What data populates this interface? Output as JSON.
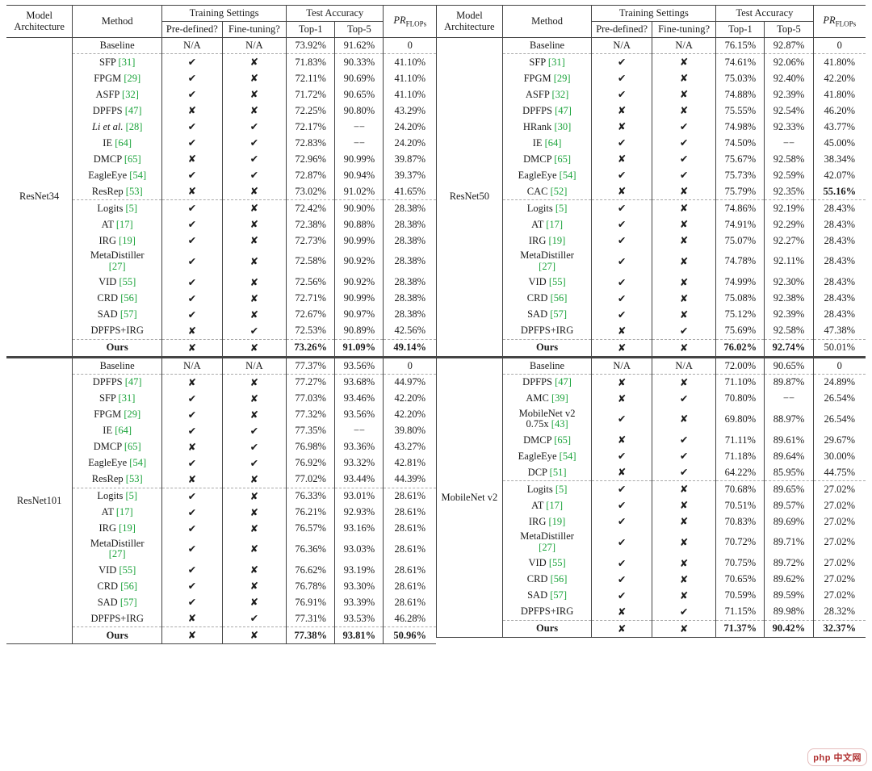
{
  "glyphs": {
    "tick": "✔",
    "cross": "✘",
    "dashes": "−−"
  },
  "headers": {
    "arch_l1": "Model",
    "arch_l2": "Architecture",
    "method": "Method",
    "ts": "Training Settings",
    "pd": "Pre-defined?",
    "ft": "Fine-tuning?",
    "ta": "Test Accuracy",
    "top1": "Top-1",
    "top5": "Top-5",
    "pr_prefix": "PR",
    "pr_sub": "FLOPs"
  },
  "blocks": [
    {
      "left": {
        "arch": "ResNet34",
        "groups": [
          {
            "rows": [
              {
                "method": "Baseline",
                "pd": "N/A",
                "ft": "N/A",
                "top1": "73.92%",
                "top5": "91.62%",
                "pr": "0"
              }
            ]
          },
          {
            "rows": [
              {
                "method": "SFP",
                "cite": "[31]",
                "pd": "T",
                "ft": "X",
                "top1": "71.83%",
                "top5": "90.33%",
                "pr": "41.10%"
              },
              {
                "method": "FPGM",
                "cite": "[29]",
                "pd": "T",
                "ft": "X",
                "top1": "72.11%",
                "top5": "90.69%",
                "pr": "41.10%"
              },
              {
                "method": "ASFP",
                "cite": "[32]",
                "pd": "T",
                "ft": "X",
                "top1": "71.72%",
                "top5": "90.65%",
                "pr": "41.10%"
              },
              {
                "method": "DPFPS",
                "cite": "[47]",
                "pd": "X",
                "ft": "X",
                "top1": "72.25%",
                "top5": "90.80%",
                "pr": "43.29%"
              },
              {
                "method": "Li et al.",
                "cite": "[28]",
                "itm": true,
                "pd": "T",
                "ft": "T",
                "top1": "72.17%",
                "top5": "DASH",
                "pr": "24.20%"
              },
              {
                "method": "IE",
                "cite": "[64]",
                "pd": "T",
                "ft": "T",
                "top1": "72.83%",
                "top5": "DASH",
                "pr": "24.20%"
              },
              {
                "method": "DMCP",
                "cite": "[65]",
                "pd": "X",
                "ft": "T",
                "top1": "72.96%",
                "top5": "90.99%",
                "pr": "39.87%"
              },
              {
                "method": "EagleEye",
                "cite": "[54]",
                "pd": "T",
                "ft": "T",
                "top1": "72.87%",
                "top5": "90.94%",
                "pr": "39.37%"
              },
              {
                "method": "ResRep",
                "cite": "[53]",
                "pd": "X",
                "ft": "X",
                "top1": "73.02%",
                "top5": "91.02%",
                "pr": "41.65%"
              }
            ]
          },
          {
            "rows": [
              {
                "method": "Logits",
                "cite": "[5]",
                "pd": "T",
                "ft": "X",
                "top1": "72.42%",
                "top5": "90.90%",
                "pr": "28.38%"
              },
              {
                "method": "AT",
                "cite": "[17]",
                "pd": "T",
                "ft": "X",
                "top1": "72.38%",
                "top5": "90.88%",
                "pr": "28.38%"
              },
              {
                "method": "IRG",
                "cite": "[19]",
                "pd": "T",
                "ft": "X",
                "top1": "72.73%",
                "top5": "90.99%",
                "pr": "28.38%"
              },
              {
                "method": "MetaDistiller",
                "cite": "[27]",
                "twoLine": true,
                "pd": "T",
                "ft": "X",
                "top1": "72.58%",
                "top5": "90.92%",
                "pr": "28.38%"
              },
              {
                "method": "VID",
                "cite": "[55]",
                "pd": "T",
                "ft": "X",
                "top1": "72.56%",
                "top5": "90.92%",
                "pr": "28.38%"
              },
              {
                "method": "CRD",
                "cite": "[56]",
                "pd": "T",
                "ft": "X",
                "top1": "72.71%",
                "top5": "90.99%",
                "pr": "28.38%"
              },
              {
                "method": "SAD",
                "cite": "[57]",
                "pd": "T",
                "ft": "X",
                "top1": "72.67%",
                "top5": "90.97%",
                "pr": "28.38%"
              },
              {
                "method": "DPFPS+IRG",
                "pd": "X",
                "ft": "T",
                "top1": "72.53%",
                "top5": "90.89%",
                "pr": "42.56%"
              }
            ]
          },
          {
            "rows": [
              {
                "method": "Ours",
                "bold": true,
                "pd": "X",
                "ft": "X",
                "top1": "73.26%",
                "top5": "91.09%",
                "pr": "49.14%",
                "boldRow": true
              }
            ]
          }
        ]
      },
      "right": {
        "arch": "ResNet50",
        "groups": [
          {
            "rows": [
              {
                "method": "Baseline",
                "pd": "N/A",
                "ft": "N/A",
                "top1": "76.15%",
                "top5": "92.87%",
                "pr": "0"
              }
            ]
          },
          {
            "rows": [
              {
                "method": "SFP",
                "cite": "[31]",
                "pd": "T",
                "ft": "X",
                "top1": "74.61%",
                "top5": "92.06%",
                "pr": "41.80%"
              },
              {
                "method": "FPGM",
                "cite": "[29]",
                "pd": "T",
                "ft": "X",
                "top1": "75.03%",
                "top5": "92.40%",
                "pr": "42.20%"
              },
              {
                "method": "ASFP",
                "cite": "[32]",
                "pd": "T",
                "ft": "X",
                "top1": "74.88%",
                "top5": "92.39%",
                "pr": "41.80%"
              },
              {
                "method": "DPFPS",
                "cite": "[47]",
                "pd": "X",
                "ft": "X",
                "top1": "75.55%",
                "top5": "92.54%",
                "pr": "46.20%"
              },
              {
                "method": "HRank",
                "cite": "[30]",
                "pd": "X",
                "ft": "T",
                "top1": "74.98%",
                "top5": "92.33%",
                "pr": "43.77%"
              },
              {
                "method": "IE",
                "cite": "[64]",
                "pd": "T",
                "ft": "T",
                "top1": "74.50%",
                "top5": "DASH",
                "pr": "45.00%"
              },
              {
                "method": "DMCP",
                "cite": "[65]",
                "pd": "X",
                "ft": "T",
                "top1": "75.67%",
                "top5": "92.58%",
                "pr": "38.34%"
              },
              {
                "method": "EagleEye",
                "cite": "[54]",
                "pd": "T",
                "ft": "T",
                "top1": "75.73%",
                "top5": "92.59%",
                "pr": "42.07%"
              },
              {
                "method": "CAC",
                "cite": "[52]",
                "pd": "X",
                "ft": "X",
                "top1": "75.79%",
                "top5": "92.35%",
                "pr": "55.16%",
                "boldPr": true
              }
            ]
          },
          {
            "rows": [
              {
                "method": "Logits",
                "cite": "[5]",
                "pd": "T",
                "ft": "X",
                "top1": "74.86%",
                "top5": "92.19%",
                "pr": "28.43%"
              },
              {
                "method": "AT",
                "cite": "[17]",
                "pd": "T",
                "ft": "X",
                "top1": "74.91%",
                "top5": "92.29%",
                "pr": "28.43%"
              },
              {
                "method": "IRG",
                "cite": "[19]",
                "pd": "T",
                "ft": "X",
                "top1": "75.07%",
                "top5": "92.27%",
                "pr": "28.43%"
              },
              {
                "method": "MetaDistiller",
                "cite": "[27]",
                "twoLine": true,
                "pd": "T",
                "ft": "X",
                "top1": "74.78%",
                "top5": "92.11%",
                "pr": "28.43%"
              },
              {
                "method": "VID",
                "cite": "[55]",
                "pd": "T",
                "ft": "X",
                "top1": "74.99%",
                "top5": "92.30%",
                "pr": "28.43%"
              },
              {
                "method": "CRD",
                "cite": "[56]",
                "pd": "T",
                "ft": "X",
                "top1": "75.08%",
                "top5": "92.38%",
                "pr": "28.43%"
              },
              {
                "method": "SAD",
                "cite": "[57]",
                "pd": "T",
                "ft": "X",
                "top1": "75.12%",
                "top5": "92.39%",
                "pr": "28.43%"
              },
              {
                "method": "DPFPS+IRG",
                "pd": "X",
                "ft": "T",
                "top1": "75.69%",
                "top5": "92.58%",
                "pr": "47.38%"
              }
            ]
          },
          {
            "rows": [
              {
                "method": "Ours",
                "bold": true,
                "pd": "X",
                "ft": "X",
                "top1": "76.02%",
                "top5": "92.74%",
                "pr": "50.01%",
                "boldRow": true,
                "prNormal": true
              }
            ]
          }
        ]
      }
    },
    {
      "left": {
        "arch": "ResNet101",
        "groups": [
          {
            "rows": [
              {
                "method": "Baseline",
                "pd": "N/A",
                "ft": "N/A",
                "top1": "77.37%",
                "top5": "93.56%",
                "pr": "0"
              }
            ]
          },
          {
            "rows": [
              {
                "method": "DPFPS",
                "cite": "[47]",
                "pd": "X",
                "ft": "X",
                "top1": "77.27%",
                "top5": "93.68%",
                "pr": "44.97%"
              },
              {
                "method": "SFP",
                "cite": "[31]",
                "pd": "T",
                "ft": "X",
                "top1": "77.03%",
                "top5": "93.46%",
                "pr": "42.20%"
              },
              {
                "method": "FPGM",
                "cite": "[29]",
                "pd": "T",
                "ft": "X",
                "top1": "77.32%",
                "top5": "93.56%",
                "pr": "42.20%"
              },
              {
                "method": "IE",
                "cite": "[64]",
                "pd": "T",
                "ft": "T",
                "top1": "77.35%",
                "top5": "DASH",
                "pr": "39.80%"
              },
              {
                "method": "DMCP",
                "cite": "[65]",
                "pd": "X",
                "ft": "T",
                "top1": "76.98%",
                "top5": "93.36%",
                "pr": "43.27%"
              },
              {
                "method": "EagleEye",
                "cite": "[54]",
                "pd": "T",
                "ft": "T",
                "top1": "76.92%",
                "top5": "93.32%",
                "pr": "42.81%"
              },
              {
                "method": "ResRep",
                "cite": "[53]",
                "pd": "X",
                "ft": "X",
                "top1": "77.02%",
                "top5": "93.44%",
                "pr": "44.39%"
              }
            ]
          },
          {
            "rows": [
              {
                "method": "Logits",
                "cite": "[5]",
                "pd": "T",
                "ft": "X",
                "top1": "76.33%",
                "top5": "93.01%",
                "pr": "28.61%"
              },
              {
                "method": "AT",
                "cite": "[17]",
                "pd": "T",
                "ft": "X",
                "top1": "76.21%",
                "top5": "92.93%",
                "pr": "28.61%"
              },
              {
                "method": "IRG",
                "cite": "[19]",
                "pd": "T",
                "ft": "X",
                "top1": "76.57%",
                "top5": "93.16%",
                "pr": "28.61%"
              },
              {
                "method": "MetaDistiller",
                "cite": "[27]",
                "twoLine": true,
                "pd": "T",
                "ft": "X",
                "top1": "76.36%",
                "top5": "93.03%",
                "pr": "28.61%"
              },
              {
                "method": "VID",
                "cite": "[55]",
                "pd": "T",
                "ft": "X",
                "top1": "76.62%",
                "top5": "93.19%",
                "pr": "28.61%"
              },
              {
                "method": "CRD",
                "cite": "[56]",
                "pd": "T",
                "ft": "X",
                "top1": "76.78%",
                "top5": "93.30%",
                "pr": "28.61%"
              },
              {
                "method": "SAD",
                "cite": "[57]",
                "pd": "T",
                "ft": "X",
                "top1": "76.91%",
                "top5": "93.39%",
                "pr": "28.61%"
              },
              {
                "method": "DPFPS+IRG",
                "pd": "X",
                "ft": "T",
                "top1": "77.31%",
                "top5": "93.53%",
                "pr": "46.28%"
              }
            ]
          },
          {
            "rows": [
              {
                "method": "Ours",
                "bold": true,
                "pd": "X",
                "ft": "X",
                "top1": "77.38%",
                "top5": "93.81%",
                "pr": "50.96%",
                "boldRow": true
              }
            ]
          }
        ]
      },
      "right": {
        "arch": "MobileNet v2",
        "groups": [
          {
            "rows": [
              {
                "method": "Baseline",
                "pd": "N/A",
                "ft": "N/A",
                "top1": "72.00%",
                "top5": "90.65%",
                "pr": "0"
              }
            ]
          },
          {
            "rows": [
              {
                "method": "DPFPS",
                "cite": "[47]",
                "pd": "X",
                "ft": "X",
                "top1": "71.10%",
                "top5": "89.87%",
                "pr": "24.89%"
              },
              {
                "method": "AMC",
                "cite": "[39]",
                "pd": "X",
                "ft": "T",
                "top1": "70.80%",
                "top5": "DASH",
                "pr": "26.54%"
              },
              {
                "method": "MobileNet v2 0.75x",
                "cite": "[43]",
                "twoLine": true,
                "methodLines": [
                  "MobileNet v2",
                  "0.75x"
                ],
                "pd": "T",
                "ft": "X",
                "top1": "69.80%",
                "top5": "88.97%",
                "pr": "26.54%"
              },
              {
                "method": "DMCP",
                "cite": "[65]",
                "pd": "X",
                "ft": "T",
                "top1": "71.11%",
                "top5": "89.61%",
                "pr": "29.67%"
              },
              {
                "method": "EagleEye",
                "cite": "[54]",
                "pd": "T",
                "ft": "T",
                "top1": "71.18%",
                "top5": "89.64%",
                "pr": "30.00%"
              },
              {
                "method": "DCP",
                "cite": "[51]",
                "pd": "X",
                "ft": "T",
                "top1": "64.22%",
                "top5": "85.95%",
                "pr": "44.75%"
              }
            ]
          },
          {
            "rows": [
              {
                "method": "Logits",
                "cite": "[5]",
                "pd": "T",
                "ft": "X",
                "top1": "70.68%",
                "top5": "89.65%",
                "pr": "27.02%"
              },
              {
                "method": "AT",
                "cite": "[17]",
                "pd": "T",
                "ft": "X",
                "top1": "70.51%",
                "top5": "89.57%",
                "pr": "27.02%"
              },
              {
                "method": "IRG",
                "cite": "[19]",
                "pd": "T",
                "ft": "X",
                "top1": "70.83%",
                "top5": "89.69%",
                "pr": "27.02%"
              },
              {
                "method": "MetaDistiller",
                "cite": "[27]",
                "twoLine": true,
                "pd": "T",
                "ft": "X",
                "top1": "70.72%",
                "top5": "89.71%",
                "pr": "27.02%"
              },
              {
                "method": "VID",
                "cite": "[55]",
                "pd": "T",
                "ft": "X",
                "top1": "70.75%",
                "top5": "89.72%",
                "pr": "27.02%"
              },
              {
                "method": "CRD",
                "cite": "[56]",
                "pd": "T",
                "ft": "X",
                "top1": "70.65%",
                "top5": "89.62%",
                "pr": "27.02%"
              },
              {
                "method": "SAD",
                "cite": "[57]",
                "pd": "T",
                "ft": "X",
                "top1": "70.59%",
                "top5": "89.59%",
                "pr": "27.02%"
              },
              {
                "method": "DPFPS+IRG",
                "pd": "X",
                "ft": "T",
                "top1": "71.15%",
                "top5": "89.98%",
                "pr": "28.32%"
              }
            ]
          },
          {
            "rows": [
              {
                "method": "Ours",
                "bold": true,
                "pd": "X",
                "ft": "X",
                "top1": "71.37%",
                "top5": "90.42%",
                "pr": "32.37%",
                "boldRow": true
              }
            ]
          }
        ]
      }
    }
  ],
  "watermark": "php 中文网"
}
